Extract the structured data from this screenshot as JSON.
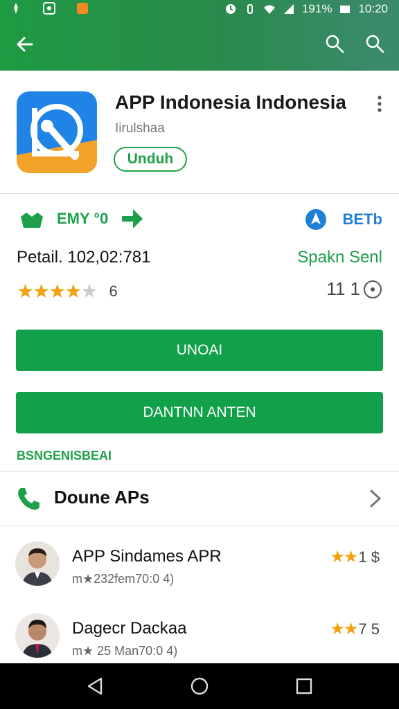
{
  "status_bar": {
    "battery": "191%",
    "time": "10:20"
  },
  "app": {
    "title": "APP Indonesia Indonesia",
    "developer": "Iirulshaa",
    "install_pill": "Unduh"
  },
  "stats": {
    "badge_left": "EMY °0",
    "badge_right": "BETb",
    "detail_label": "Petail.  102,02:781",
    "detail_right": "Spakn Senl",
    "rating_stars": 3.5,
    "rating_count": "6",
    "reviews_text": "11 1"
  },
  "buttons": {
    "primary": "UNOAI",
    "secondary": "DANTNN ANTEN"
  },
  "section_link": "BSNGENISBEAI",
  "similar": {
    "label": "Doune APs"
  },
  "reviews": [
    {
      "name": "APP Sindames APR",
      "meta": "m★232fem70:0 4)",
      "stars": 2,
      "score": "1  $"
    },
    {
      "name": "Dagecr Dackaa",
      "meta": "m★ 25 Man70:0 4)",
      "stars": 2,
      "score": "7  5"
    }
  ],
  "colors": {
    "accent_green": "#13a04a",
    "star": "#f1a10d",
    "blue": "#1f7fd6"
  }
}
